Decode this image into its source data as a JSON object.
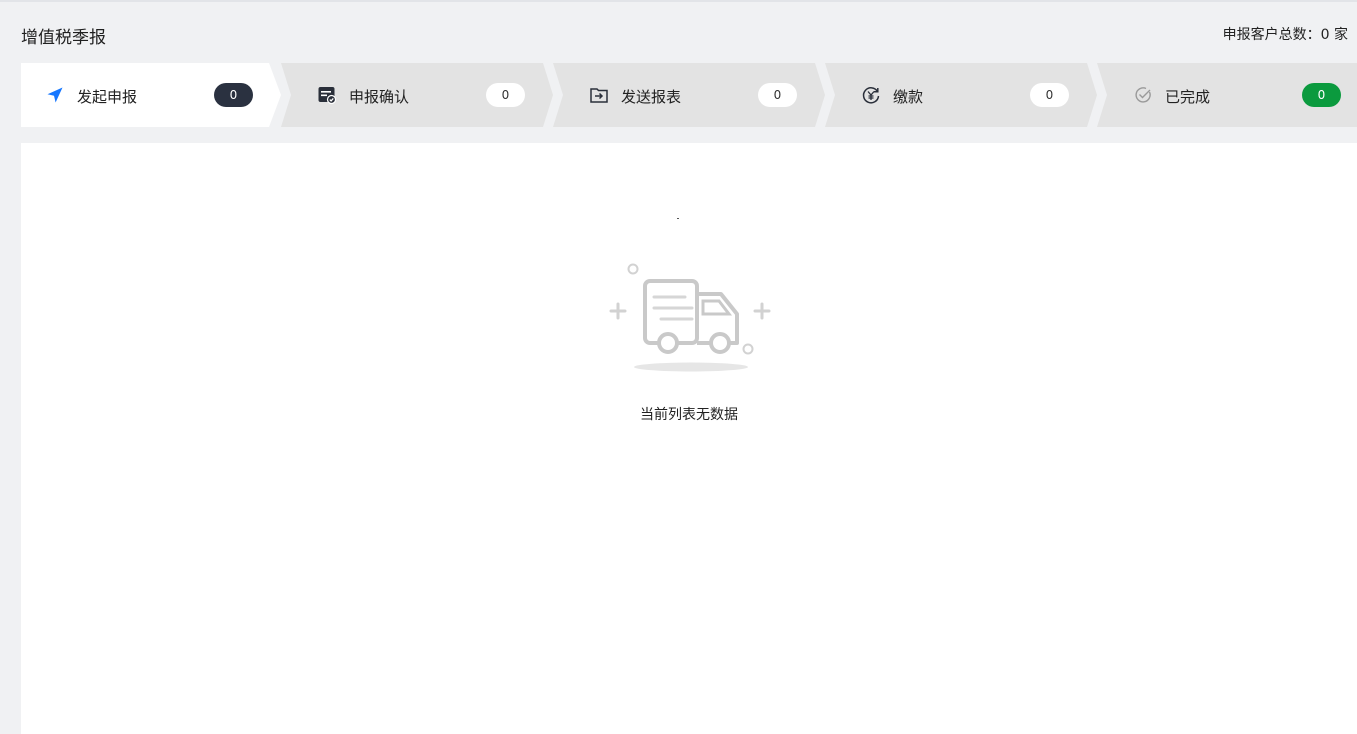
{
  "header": {
    "title": "增值税季报",
    "summary": "申报客户总数：0 家"
  },
  "steps": [
    {
      "label": "发起申报",
      "count": "0",
      "icon": "navigation-arrow-icon",
      "active": true,
      "badge_color": "#2a3140"
    },
    {
      "label": "申报确认",
      "count": "0",
      "icon": "form-check-icon",
      "active": false,
      "badge_color": "#ffffff"
    },
    {
      "label": "发送报表",
      "count": "0",
      "icon": "send-box-icon",
      "active": false,
      "badge_color": "#ffffff"
    },
    {
      "label": "缴款",
      "count": "0",
      "icon": "yen-cycle-icon",
      "active": false,
      "badge_color": "#ffffff"
    },
    {
      "label": "已完成",
      "count": "0",
      "icon": "check-circle-icon",
      "active": false,
      "badge_color": "#0b9a3e"
    }
  ],
  "empty_state": {
    "icon": "empty-truck-icon",
    "message": "当前列表无数据"
  },
  "colors": {
    "accent_blue": "#1677ff",
    "dark_badge": "#2a3140",
    "success_green": "#0b9a3e",
    "step_inactive_bg": "#e3e3e3",
    "page_bg": "#f0f1f3"
  }
}
